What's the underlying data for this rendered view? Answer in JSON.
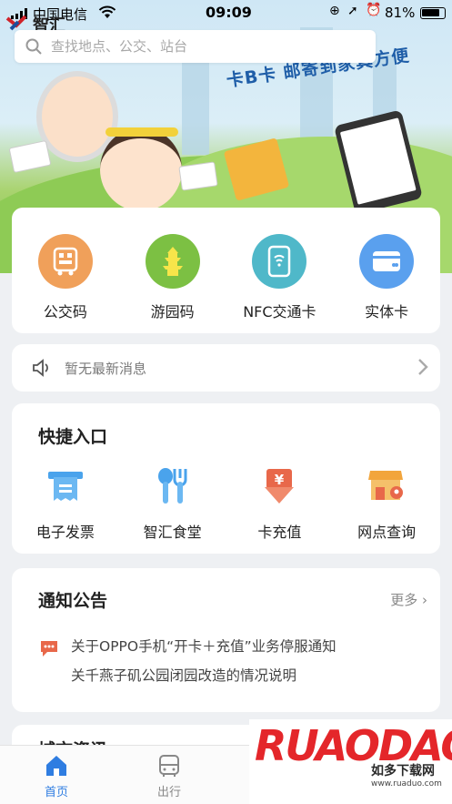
{
  "status_bar": {
    "carrier": "中国电信",
    "time": "09:09",
    "battery": "81%"
  },
  "app_logo": "智汇",
  "banner": {
    "slogan": "卡B卡  邮寄到家真方便"
  },
  "search": {
    "placeholder": "查找地点、公交、站台"
  },
  "main_services": [
    {
      "label": "公交码",
      "icon": "bus-qr-icon",
      "color": "#f0a05a"
    },
    {
      "label": "游园码",
      "icon": "pagoda-icon",
      "color": "#7cc043"
    },
    {
      "label": "NFC交通卡",
      "icon": "nfc-phone-icon",
      "color": "#4fb8c9"
    },
    {
      "label": "实体卡",
      "icon": "card-icon",
      "color": "#5aa0ee"
    }
  ],
  "notice_bar": {
    "text": "暂无最新消息"
  },
  "quick_entry": {
    "title": "快捷入口",
    "items": [
      {
        "label": "电子发票",
        "icon": "invoice-icon"
      },
      {
        "label": "智汇食堂",
        "icon": "canteen-icon"
      },
      {
        "label": "卡充值",
        "icon": "recharge-icon"
      },
      {
        "label": "网点查询",
        "icon": "outlet-icon"
      }
    ]
  },
  "announcements": {
    "title": "通知公告",
    "more": "更多",
    "items": [
      "关于OPPO手机“开卡＋充值”业务停服通知",
      "关千燕子矶公园闭园改造的情况说明"
    ]
  },
  "next_section": {
    "title": "城市资讯"
  },
  "tabbar": {
    "items": [
      {
        "label": "首页",
        "active": true
      },
      {
        "label": "出行",
        "active": false
      }
    ]
  },
  "watermark": {
    "brand": "RUAODAO",
    "name": "如多下载网",
    "url": "www.ruaduo.com"
  },
  "colors": {
    "accent": "#2f7de1",
    "orange": "#f0a05a",
    "red_icon": "#e8684a"
  }
}
